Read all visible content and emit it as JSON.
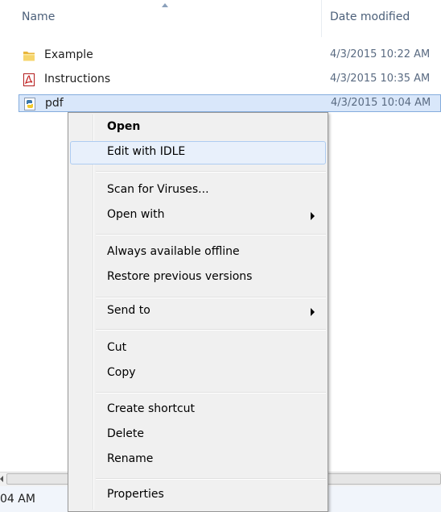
{
  "columns": {
    "name": "Name",
    "date_modified": "Date modified"
  },
  "files": [
    {
      "name": "Example",
      "date": "4/3/2015 10:22 AM",
      "icon": "folder-icon"
    },
    {
      "name": "Instructions",
      "date": "4/3/2015 10:35 AM",
      "icon": "pdf-file-icon"
    },
    {
      "name": "pdf",
      "date": "4/3/2015 10:04 AM",
      "icon": "python-file-icon",
      "selected": true
    }
  ],
  "status_text": "04 AM",
  "context_menu": {
    "open": "Open",
    "edit_with_idle": "Edit with IDLE",
    "scan_for_viruses": "Scan for Viruses...",
    "open_with": "Open with",
    "always_available_offline": "Always available offline",
    "restore_previous_versions": "Restore previous versions",
    "send_to": "Send to",
    "cut": "Cut",
    "copy": "Copy",
    "create_shortcut": "Create shortcut",
    "delete": "Delete",
    "rename": "Rename",
    "properties": "Properties"
  }
}
